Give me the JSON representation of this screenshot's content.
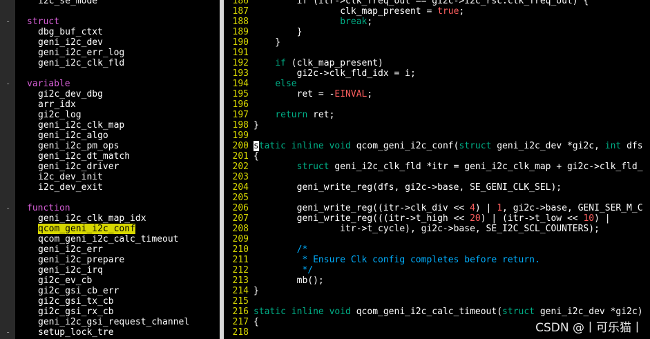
{
  "taglist": {
    "gutter_marks": [
      "-",
      "-",
      "-",
      "-"
    ],
    "rows": [
      {
        "text": "i2c_se_mode",
        "kind": "tag"
      },
      {
        "text": "",
        "kind": "blank"
      },
      {
        "text": "struct",
        "kind": "head"
      },
      {
        "text": "dbg_buf_ctxt",
        "kind": "tag"
      },
      {
        "text": "geni_i2c_dev",
        "kind": "tag"
      },
      {
        "text": "geni_i2c_err_log",
        "kind": "tag"
      },
      {
        "text": "geni_i2c_clk_fld",
        "kind": "tag"
      },
      {
        "text": "",
        "kind": "blank"
      },
      {
        "text": "variable",
        "kind": "head"
      },
      {
        "text": "gi2c_dev_dbg",
        "kind": "tag"
      },
      {
        "text": "arr_idx",
        "kind": "tag"
      },
      {
        "text": "gi2c_log",
        "kind": "tag"
      },
      {
        "text": "geni_i2c_clk_map",
        "kind": "tag"
      },
      {
        "text": "geni_i2c_algo",
        "kind": "tag"
      },
      {
        "text": "geni_i2c_pm_ops",
        "kind": "tag"
      },
      {
        "text": "geni_i2c_dt_match",
        "kind": "tag"
      },
      {
        "text": "geni_i2c_driver",
        "kind": "tag"
      },
      {
        "text": "i2c_dev_init",
        "kind": "tag"
      },
      {
        "text": "i2c_dev_exit",
        "kind": "tag"
      },
      {
        "text": "",
        "kind": "blank"
      },
      {
        "text": "function",
        "kind": "head"
      },
      {
        "text": "geni_i2c_clk_map_idx",
        "kind": "tag"
      },
      {
        "text": "qcom_geni_i2c_conf",
        "kind": "selected"
      },
      {
        "text": "qcom_geni_i2c_calc_timeout",
        "kind": "tag"
      },
      {
        "text": "geni_i2c_err",
        "kind": "tag"
      },
      {
        "text": "geni_i2c_prepare",
        "kind": "tag"
      },
      {
        "text": "geni_i2c_irq",
        "kind": "tag"
      },
      {
        "text": "gi2c_ev_cb",
        "kind": "tag"
      },
      {
        "text": "gi2c_gsi_cb_err",
        "kind": "tag"
      },
      {
        "text": "gi2c_gsi_tx_cb",
        "kind": "tag"
      },
      {
        "text": "gi2c_gsi_rx_cb",
        "kind": "tag"
      },
      {
        "text": "geni_i2c_gsi_request_channel",
        "kind": "tag"
      },
      {
        "text": "setup_lock_tre",
        "kind": "tag"
      }
    ]
  },
  "editor": {
    "lines": [
      {
        "n": "186",
        "segs": [
          [
            "        if (itr->clk_freq_out == gi2c->i2c_rsc.clk_freq_out) {",
            ""
          ]
        ]
      },
      {
        "n": "187",
        "segs": [
          [
            "                clk_map_present = ",
            ""
          ],
          [
            "true",
            "cst"
          ],
          [
            ";",
            ""
          ]
        ]
      },
      {
        "n": "188",
        "segs": [
          [
            "                ",
            ""
          ],
          [
            "break",
            "kw"
          ],
          [
            ";",
            ""
          ]
        ]
      },
      {
        "n": "189",
        "segs": [
          [
            "        }",
            ""
          ]
        ]
      },
      {
        "n": "190",
        "segs": [
          [
            "    }",
            ""
          ]
        ]
      },
      {
        "n": "191",
        "segs": [
          [
            "",
            ""
          ]
        ]
      },
      {
        "n": "192",
        "segs": [
          [
            "    ",
            ""
          ],
          [
            "if",
            "kw"
          ],
          [
            " (clk_map_present)",
            ""
          ]
        ]
      },
      {
        "n": "193",
        "segs": [
          [
            "        gi2c->clk_fld_idx = i;",
            ""
          ]
        ]
      },
      {
        "n": "194",
        "segs": [
          [
            "    ",
            ""
          ],
          [
            "else",
            "kw"
          ]
        ]
      },
      {
        "n": "195",
        "segs": [
          [
            "        ret = -",
            ""
          ],
          [
            "EINVAL",
            "cst"
          ],
          [
            ";",
            ""
          ]
        ]
      },
      {
        "n": "196",
        "segs": [
          [
            "",
            ""
          ]
        ]
      },
      {
        "n": "197",
        "segs": [
          [
            "    ",
            ""
          ],
          [
            "return",
            "kw"
          ],
          [
            " ret;",
            ""
          ]
        ]
      },
      {
        "n": "198",
        "segs": [
          [
            "}",
            ""
          ]
        ]
      },
      {
        "n": "199",
        "segs": [
          [
            "",
            ""
          ]
        ]
      },
      {
        "n": "200",
        "segs": [
          [
            "s",
            "cursor"
          ],
          [
            "tatic inline void",
            "kw"
          ],
          [
            " qcom_geni_i2c_conf(",
            ""
          ],
          [
            "struct",
            "ty"
          ],
          [
            " geni_i2c_dev *gi2c, ",
            ""
          ],
          [
            "int",
            "ty"
          ],
          [
            " dfs",
            ""
          ]
        ]
      },
      {
        "n": "201",
        "segs": [
          [
            "{",
            ""
          ]
        ]
      },
      {
        "n": "202",
        "segs": [
          [
            "        ",
            ""
          ],
          [
            "struct",
            "ty"
          ],
          [
            " geni_i2c_clk_fld *itr = geni_i2c_clk_map + gi2c->clk_fld_",
            ""
          ]
        ]
      },
      {
        "n": "203",
        "segs": [
          [
            "",
            ""
          ]
        ]
      },
      {
        "n": "204",
        "segs": [
          [
            "        geni_write_reg(dfs, gi2c->base, SE_GENI_CLK_SEL);",
            ""
          ]
        ]
      },
      {
        "n": "205",
        "segs": [
          [
            "",
            ""
          ]
        ]
      },
      {
        "n": "206",
        "segs": [
          [
            "        geni_write_reg((itr->clk_div << ",
            ""
          ],
          [
            "4",
            "num"
          ],
          [
            ") | ",
            ""
          ],
          [
            "1",
            "num"
          ],
          [
            ", gi2c->base, GENI_SER_M_C",
            ""
          ]
        ]
      },
      {
        "n": "207",
        "segs": [
          [
            "        geni_write_reg(((itr->t_high << ",
            ""
          ],
          [
            "20",
            "num"
          ],
          [
            ") | (itr->t_low << ",
            ""
          ],
          [
            "10",
            "num"
          ],
          [
            ") |",
            ""
          ]
        ]
      },
      {
        "n": "208",
        "segs": [
          [
            "                itr->t_cycle), gi2c->base, SE_I2C_SCL_COUNTERS);",
            ""
          ]
        ]
      },
      {
        "n": "209",
        "segs": [
          [
            "",
            ""
          ]
        ]
      },
      {
        "n": "210",
        "segs": [
          [
            "        /*",
            "cm"
          ]
        ]
      },
      {
        "n": "211",
        "segs": [
          [
            "         * Ensure Clk config completes before return.",
            "cm"
          ]
        ]
      },
      {
        "n": "212",
        "segs": [
          [
            "         */",
            "cm"
          ]
        ]
      },
      {
        "n": "213",
        "segs": [
          [
            "        mb();",
            ""
          ]
        ]
      },
      {
        "n": "214",
        "segs": [
          [
            "}",
            ""
          ]
        ]
      },
      {
        "n": "215",
        "segs": [
          [
            "",
            ""
          ]
        ]
      },
      {
        "n": "216",
        "segs": [
          [
            "static inline void",
            "kw"
          ],
          [
            " qcom_geni_i2c_calc_timeout(",
            ""
          ],
          [
            "struct",
            "ty"
          ],
          [
            " geni_i2c_dev *gi2c)",
            ""
          ]
        ]
      },
      {
        "n": "217",
        "segs": [
          [
            "{",
            ""
          ]
        ]
      },
      {
        "n": "218",
        "segs": [
          [
            "",
            ""
          ]
        ]
      }
    ]
  },
  "watermark": "CSDN @丨可乐猫丨",
  "colors": {
    "line_number": "#d7d700",
    "keyword": "#00af87",
    "comment": "#00afff",
    "constant": "#ff5f5f",
    "heading": "#d75fd7",
    "selection": "#d7d700"
  }
}
